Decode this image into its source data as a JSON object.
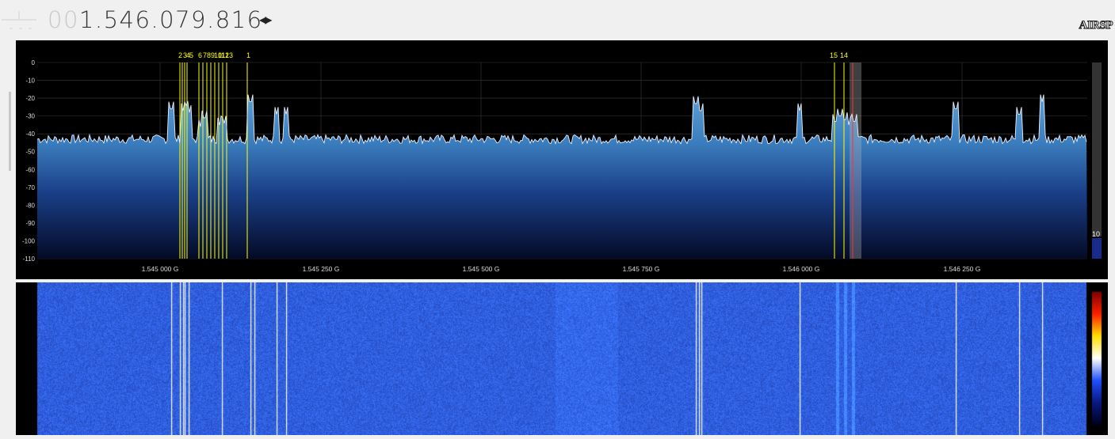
{
  "header": {
    "frequency_lead": "00",
    "frequency_main": "1.546.079.816",
    "step_arrows": "◀▶",
    "brand": "AIRSP"
  },
  "spectrum": {
    "db_scale_labels": [
      "0",
      "-10",
      "-20",
      "-30",
      "-40",
      "-50",
      "-60",
      "-70",
      "-80",
      "-90",
      "-100",
      "-110"
    ],
    "freq_labels": [
      "1.545 000 G",
      "1.545 250 G",
      "1.545 500 G",
      "1.545 750 G",
      "1.546 000 G",
      "1.546 250 G"
    ],
    "marker_labels": [
      "2",
      "3",
      "4",
      "5",
      "6",
      "7",
      "8",
      "9",
      "10",
      "11",
      "12",
      "13",
      "1",
      "15",
      "14"
    ],
    "contrast_value": "10",
    "colors": {
      "background": "#000000",
      "fill_top": "#4a8fc6",
      "fill_bottom": "#050d2a",
      "trace": "#e8f0ff",
      "marker": "#ffff00",
      "center_line": "#ff3030"
    }
  },
  "waterfall": {
    "colors": {
      "background": "#0b1f8a",
      "signal_line": "#ffffff"
    },
    "palette": [
      "#000020",
      "#0a1880",
      "#2050ff",
      "#ffffff",
      "#ffe000",
      "#ff2000",
      "#800000"
    ]
  }
}
